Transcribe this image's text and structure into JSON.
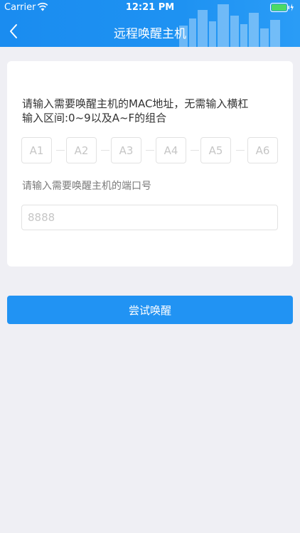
{
  "status_bar": {
    "carrier": "Carrier",
    "time": "12:21 PM"
  },
  "nav": {
    "title": "远程唤醒主机",
    "back_icon": "chevron-left-icon"
  },
  "form": {
    "instruction_line1": "请输入需要唤醒主机的MAC地址，无需输入横杠",
    "instruction_line2": "输入区间:0~9以及A~F的组合",
    "mac_placeholders": [
      "A1",
      "A2",
      "A3",
      "A4",
      "A5",
      "A6"
    ],
    "port_label": "请输入需要唤醒主机的端口号",
    "port_placeholder": "8888"
  },
  "actions": {
    "wake_label": "尝试唤醒"
  },
  "colors": {
    "accent": "#2193f3",
    "background": "#efeff4",
    "battery": "#4cd964"
  }
}
